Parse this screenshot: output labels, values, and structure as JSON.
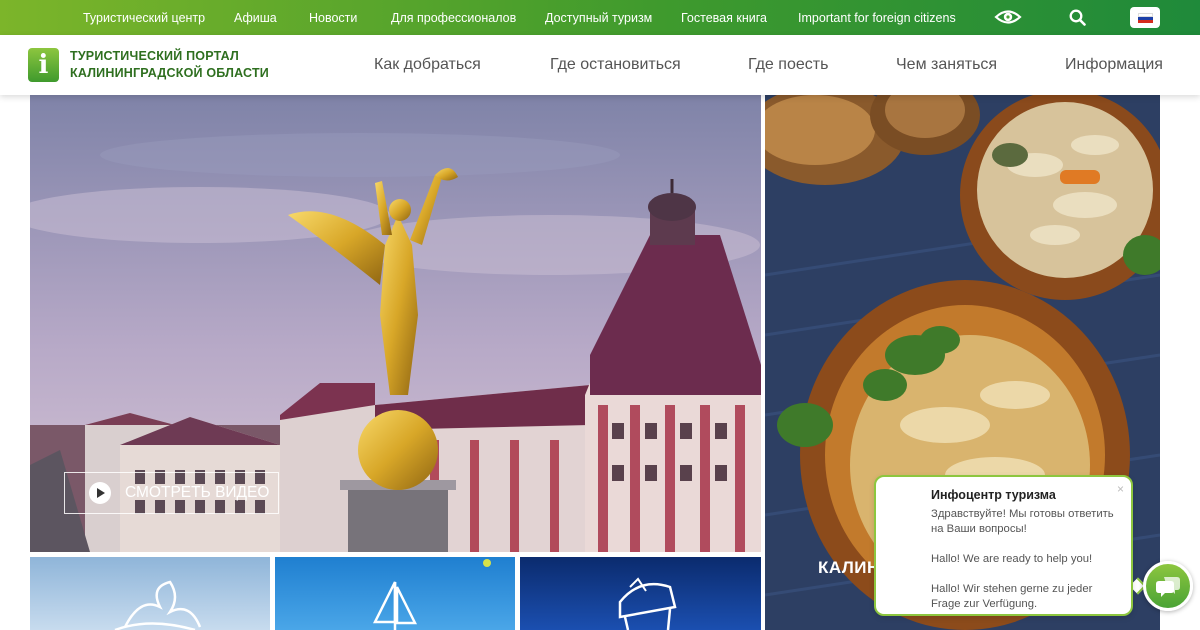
{
  "topbar": {
    "links": [
      "Туристический центр",
      "Афиша",
      "Новости",
      "Для профессионалов",
      "Доступный туризм",
      "Гостевая книга",
      "Important for foreign citizens"
    ],
    "icons": [
      "eye-icon",
      "search-icon",
      "flag-ru-icon"
    ]
  },
  "header": {
    "logo_letter": "i",
    "logo_line1": "ТУРИСТИЧЕСКИЙ ПОРТАЛ",
    "logo_line2": "КАЛИНИНГРАДСКОЙ ОБЛАСТИ",
    "nav": [
      "Как добраться",
      "Где остановиться",
      "Где поесть",
      "Чем заняться",
      "Информация"
    ]
  },
  "hero": {
    "video_button": "СМОТРЕТЬ ВИДЕО"
  },
  "food": {
    "label": "КАЛИН"
  },
  "chat": {
    "title": "Инфоцентр туризма",
    "ru": "Здравствуйте! Мы готовы ответить на Ваши вопросы!",
    "en": "Hallo! We are ready to help you!",
    "de": "Hallo! Wir stehen gerne zu jeder Frage zur Verfügung.",
    "close": "×"
  },
  "colors": {
    "brand_green": "#3f9a2d",
    "light_green": "#8dc63f",
    "logo_text": "#2e6f1f"
  }
}
